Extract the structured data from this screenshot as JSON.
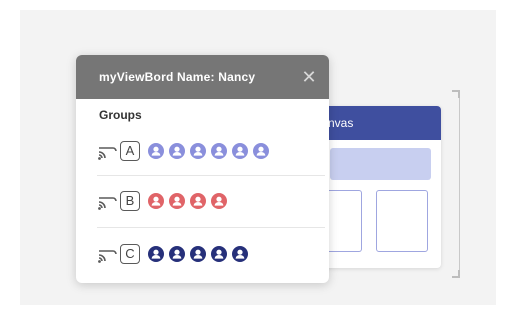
{
  "popup": {
    "title": "myViewBord Name: Nancy",
    "close_icon": "close-icon",
    "groups_label": "Groups"
  },
  "groups": [
    {
      "letter": "A",
      "member_count": 6,
      "color": "#8a8fdc"
    },
    {
      "letter": "B",
      "member_count": 4,
      "color": "#e06468"
    },
    {
      "letter": "C",
      "member_count": 5,
      "color": "#26307a"
    }
  ],
  "canvas": {
    "header_text": "nvas",
    "header_color": "#3f4f9f"
  }
}
